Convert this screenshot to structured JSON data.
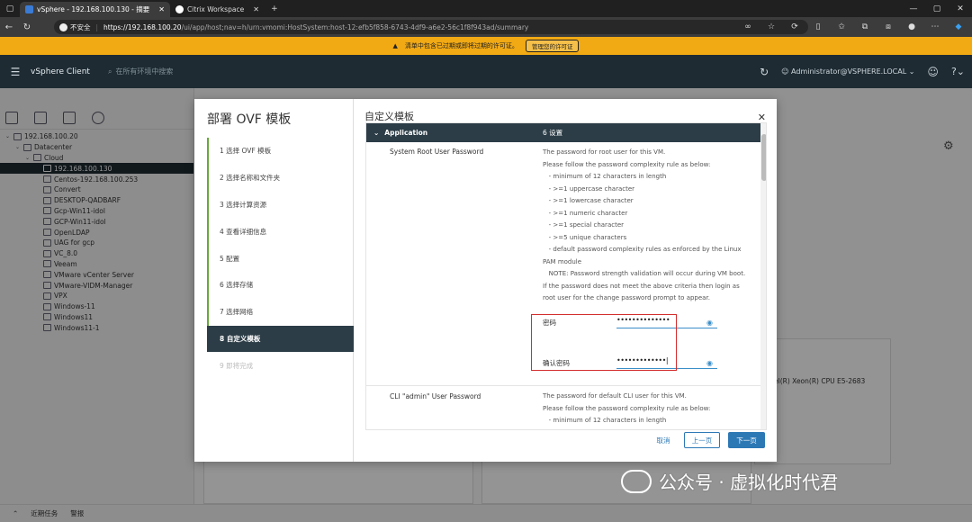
{
  "browser": {
    "tabs": [
      {
        "label": "vSphere - 192.168.100.130 - 摘要",
        "active": true
      },
      {
        "label": "Citrix Workspace",
        "active": false
      }
    ],
    "new_tab": "+",
    "security_label": "不安全",
    "url_host": "https://192.168.100.20",
    "url_path": "/ui/app/host;nav=h/urn:vmomi:HostSystem:host-12:efb5f858-6743-4df9-a6e2-56c1f8f943ad/summary"
  },
  "banner": {
    "message": "清单中包含已过期或即将过期的许可证。",
    "button": "管理您的许可证",
    "color": "#f1a914"
  },
  "vsphere": {
    "brand": "vSphere Client",
    "search_placeholder": "在所有环境中搜索",
    "user": "Administrator@VSPHERE.LOCAL"
  },
  "tree": [
    {
      "label": "192.168.100.20",
      "indent": 0,
      "caret": "⌄",
      "selected": false
    },
    {
      "label": "Datacenter",
      "indent": 1,
      "caret": "⌄",
      "selected": false
    },
    {
      "label": "Cloud",
      "indent": 2,
      "caret": "⌄",
      "selected": false
    },
    {
      "label": "192.168.100.130",
      "indent": 3,
      "caret": "",
      "selected": true
    },
    {
      "label": "Centos-192.168.100.253",
      "indent": 3,
      "caret": "",
      "selected": false
    },
    {
      "label": "Convert",
      "indent": 3,
      "caret": "",
      "selected": false
    },
    {
      "label": "DESKTOP-QADBARF",
      "indent": 3,
      "caret": "",
      "selected": false
    },
    {
      "label": "Gcp-Win11-idol",
      "indent": 3,
      "caret": "",
      "selected": false
    },
    {
      "label": "GCP-Win11-idol",
      "indent": 3,
      "caret": "",
      "selected": false
    },
    {
      "label": "OpenLDAP",
      "indent": 3,
      "caret": "",
      "selected": false
    },
    {
      "label": "UAG for gcp",
      "indent": 3,
      "caret": "",
      "selected": false
    },
    {
      "label": "VC_8.0",
      "indent": 3,
      "caret": "",
      "selected": false
    },
    {
      "label": "Veeam",
      "indent": 3,
      "caret": "",
      "selected": false
    },
    {
      "label": "VMware vCenter Server",
      "indent": 3,
      "caret": "",
      "selected": false
    },
    {
      "label": "VMware-VIDM-Manager",
      "indent": 3,
      "caret": "",
      "selected": false
    },
    {
      "label": "VPX",
      "indent": 3,
      "caret": "",
      "selected": false
    },
    {
      "label": "Windows-11",
      "indent": 3,
      "caret": "",
      "selected": false
    },
    {
      "label": "Windows11",
      "indent": 3,
      "caret": "",
      "selected": false
    },
    {
      "label": "Windows11-1",
      "indent": 3,
      "caret": "",
      "selected": false
    }
  ],
  "background": {
    "cpu_text": "el(R) Xeon(R) CPU E5-2683"
  },
  "bottom_bar": {
    "recent_tasks": "近期任务",
    "alarms": "警报"
  },
  "dialog": {
    "title": "部署 OVF 模板",
    "subtitle": "自定义模板",
    "steps": [
      {
        "label": "1  选择 OVF 模板",
        "state": "done"
      },
      {
        "label": "2  选择名称和文件夹",
        "state": "done"
      },
      {
        "label": "3  选择计算资源",
        "state": "done"
      },
      {
        "label": "4  查看详细信息",
        "state": "done"
      },
      {
        "label": "5  配置",
        "state": "done"
      },
      {
        "label": "6  选择存储",
        "state": "done"
      },
      {
        "label": "7  选择网络",
        "state": "done"
      },
      {
        "label": "8  自定义模板",
        "state": "active"
      },
      {
        "label": "9  即将完成",
        "state": "disabled"
      }
    ],
    "section": {
      "name": "Application",
      "count": "6 设置"
    },
    "root_password": {
      "label": "System Root User Password",
      "description": [
        "The password for root user for this VM.",
        "Please follow the password complexity rule as below:",
        "   - minimum of 12 characters in length",
        "   - >=1 uppercase character",
        "   - >=1 lowercase character",
        "   - >=1 numeric character",
        "   - >=1 special character",
        "   - >=5 unique characters",
        "   - default password complexity rules as enforced by the Linux",
        "PAM module",
        "   NOTE: Password strength validation will occur during VM boot.",
        "If the password does not meet the above criteria then login as",
        "root user for the change password prompt to appear."
      ],
      "password_label": "密码",
      "password_value": "••••••••••••••",
      "confirm_label": "确认密码",
      "confirm_value": "•••••••••••••|"
    },
    "cli_password": {
      "label": "CLI \"admin\" User Password",
      "description": [
        "The password for default CLI user for this VM.",
        "Please follow the password complexity rule as below:",
        "   - minimum of 12 characters in length"
      ]
    },
    "buttons": {
      "cancel": "取消",
      "prev": "上一页",
      "next": "下一页"
    }
  },
  "watermark": "公众号 · 虚拟化时代君"
}
